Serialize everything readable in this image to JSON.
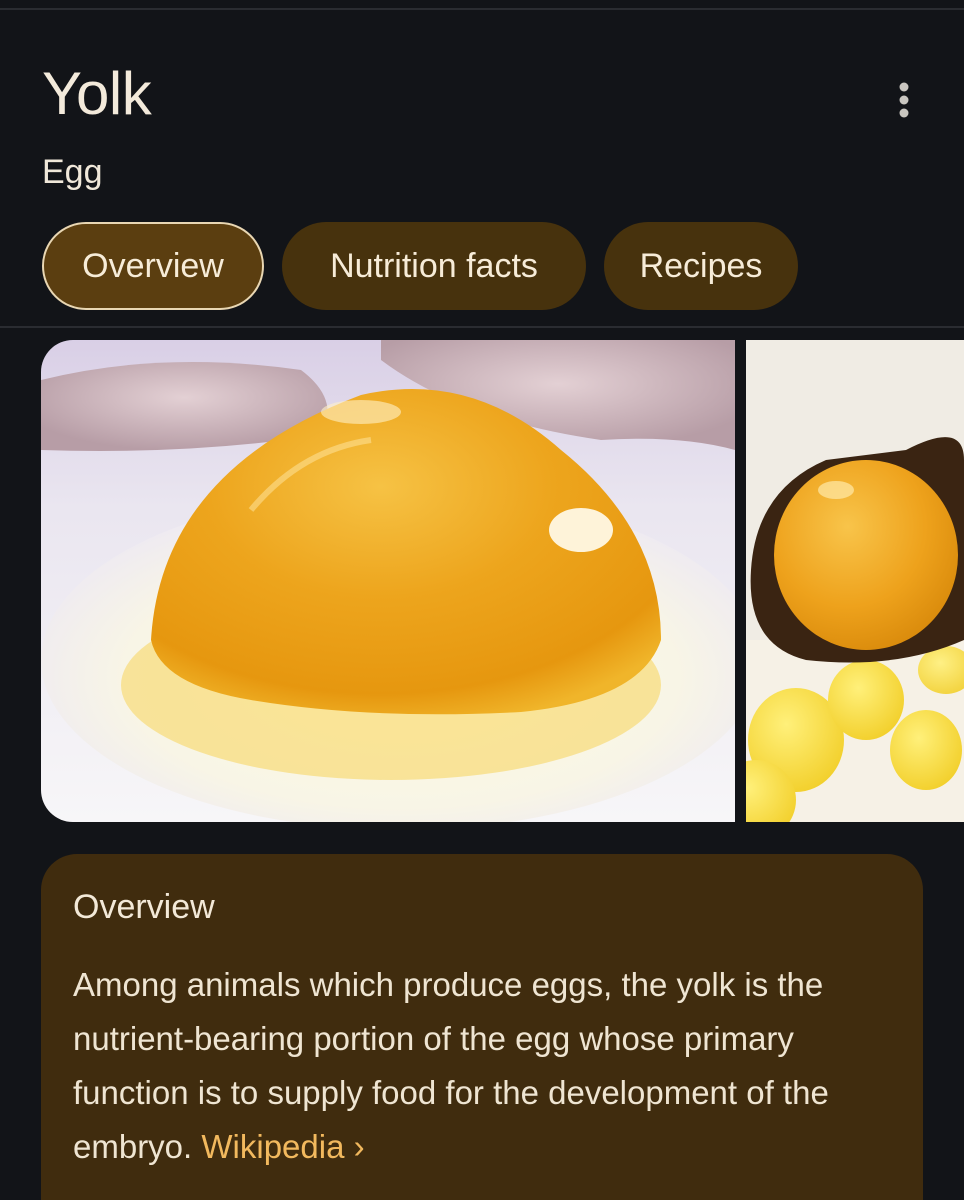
{
  "entity": {
    "title": "Yolk",
    "subtitle": "Egg"
  },
  "tabs": [
    {
      "label": "Overview",
      "active": true
    },
    {
      "label": "Nutrition facts",
      "active": false
    },
    {
      "label": "Recipes",
      "active": false
    }
  ],
  "images": [
    {
      "description": "raw egg yolk on white"
    },
    {
      "description": "egg yolk on a spoon"
    }
  ],
  "overview": {
    "heading": "Overview",
    "text": "Among animals which produce eggs, the yolk is the nutrient-bearing portion of the egg whose primary function is to supply food for the development of the embryo.",
    "source_label": "Wikipedia",
    "source_chevron": "›"
  },
  "icons": {
    "more": "more-vert-icon",
    "link_chevron": "chevron-right-icon"
  },
  "colors": {
    "background": "#121418",
    "tab_fill": "#47320d",
    "tab_active_fill": "#5b3e10",
    "card_fill": "#402c0e",
    "link": "#f2b95e"
  }
}
